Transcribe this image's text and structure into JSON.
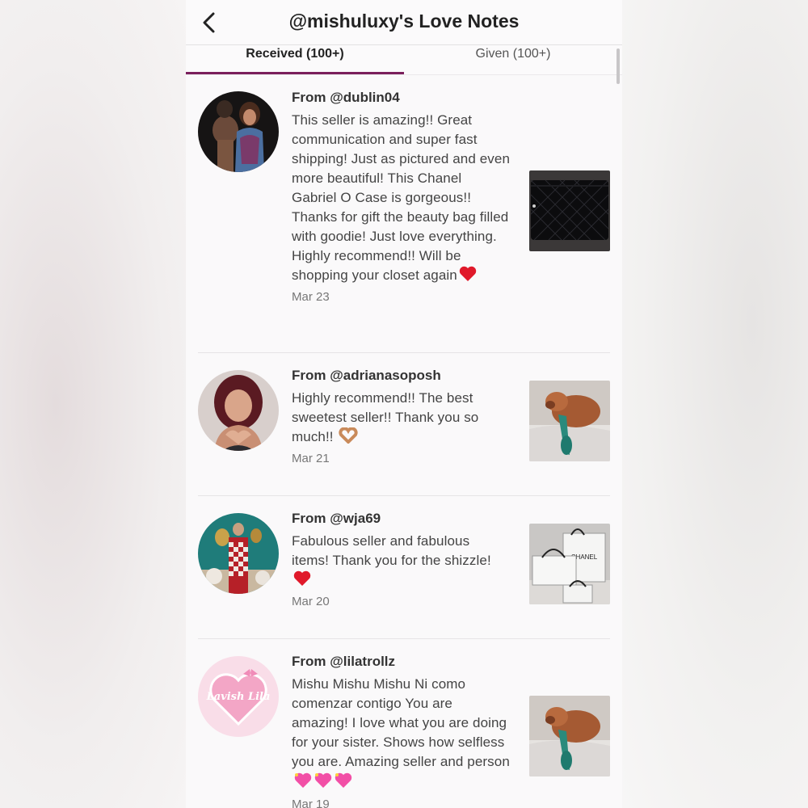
{
  "header": {
    "title": "@mishuluxy's Love Notes",
    "back_icon": "chevron-left-icon"
  },
  "tabs": [
    {
      "label": "Received (100+)",
      "active": true
    },
    {
      "label": "Given (100+)",
      "active": false
    }
  ],
  "notes": [
    {
      "from": "From @dublin04",
      "text": "This seller is amazing!! Great communication and super fast shipping! Just as pictured and even more beautiful! This Chanel Gabriel O Case is gorgeous!! Thanks for gift the beauty bag filled with goodie! Just love everything. Highly recommend!! Will be shopping your closet again",
      "emoji": "red-heart",
      "date": "Mar 23",
      "thumb": "black-quilted-bag"
    },
    {
      "from": "From @adrianasoposh",
      "text": "Highly recommend!! The best sweetest seller!! Thank you so much!!",
      "emoji": "heart-hands",
      "date": "Mar 21",
      "thumb": "dog-on-bed"
    },
    {
      "from": "From @wja69",
      "text": "Fabulous seller and fabulous items! Thank you for the shizzle!",
      "emoji": "red-heart",
      "date": "Mar 20",
      "thumb": "chanel-shopping-bags"
    },
    {
      "from": "From @lilatrollz",
      "text": "Mishu Mishu Mishu Ni como comenzar contigo You are amazing! I love what you are doing for your sister. Shows how selfless you are. Amazing seller and person",
      "emoji": "sparkling-hearts",
      "date": "Mar 19",
      "thumb": "dog-on-bed",
      "avatar_text": "Lavish Lila"
    }
  ],
  "colors": {
    "accent": "#7a1f5c",
    "heart": "#e0192a",
    "sparkle_heart": "#f24fa6"
  }
}
